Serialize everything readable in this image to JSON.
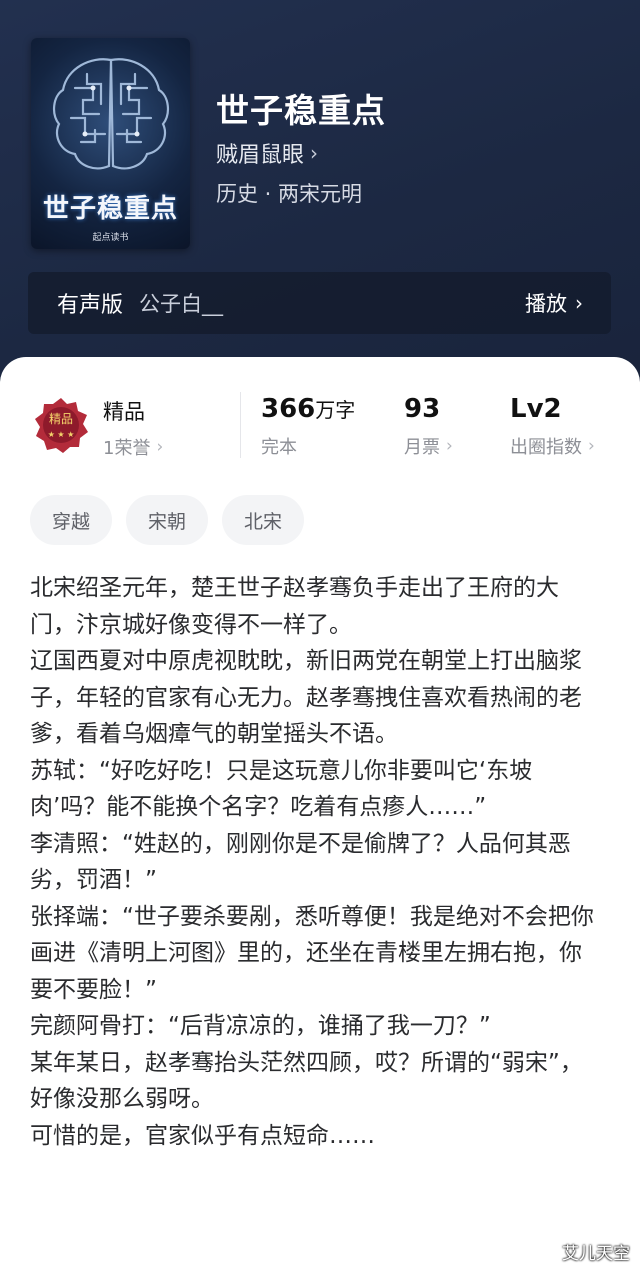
{
  "book": {
    "cover_title": "世子稳重点",
    "cover_publisher": "起点读书",
    "title": "世子稳重点",
    "author": "贼眉鼠眼",
    "genre": "历史 · 两宋元明"
  },
  "audio": {
    "label": "有声版",
    "narrator": "公子白__",
    "play": "播放"
  },
  "quality": {
    "title": "精品",
    "honors": "1荣誉",
    "badge_text": "精品"
  },
  "stats": {
    "words_value": "366",
    "words_unit": "万字",
    "words_label": "完本",
    "tickets_value": "93",
    "tickets_label": "月票",
    "level_value": "Lv2",
    "level_label": "出圈指数"
  },
  "tags": [
    "穿越",
    "宋朝",
    "北宋"
  ],
  "synopsis": [
    "北宋绍圣元年，楚王世子赵孝骞负手走出了王府的大门，汴京城好像变得不一样了。",
    "辽国西夏对中原虎视眈眈，新旧两党在朝堂上打出脑浆子，年轻的官家有心无力。赵孝骞拽住喜欢看热闹的老爹，看着乌烟瘴气的朝堂摇头不语。",
    "苏轼：“好吃好吃！只是这玩意儿你非要叫它‘东坡肉’吗？能不能换个名字？吃着有点瘆人……”",
    "李清照：“姓赵的，刚刚你是不是偷牌了？人品何其恶劣，罚酒！”",
    "张择端：“世子要杀要剐，悉听尊便！我是绝对不会把你画进《清明上河图》里的，还坐在青楼里左拥右抱，你要不要脸！”",
    "完颜阿骨打：“后背凉凉的，谁捅了我一刀？”",
    "某年某日，赵孝骞抬头茫然四顾，哎？所谓的“弱宋”，好像没那么弱呀。",
    "可惜的是，官家似乎有点短命……"
  ],
  "watermark": "艾儿天空",
  "icons": {
    "chevron": "chevron-right-icon",
    "badge": "quality-badge-icon"
  }
}
